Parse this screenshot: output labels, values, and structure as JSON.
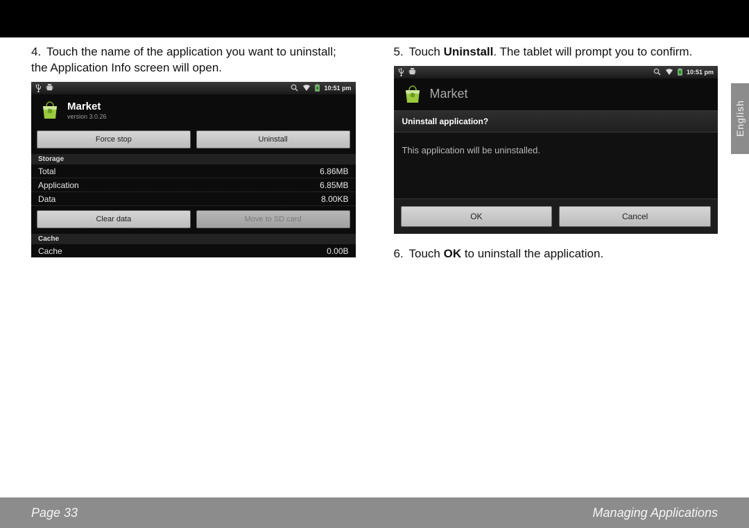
{
  "side_tab": "English",
  "footer": {
    "left": "Page 33",
    "right": "Managing Applications"
  },
  "steps": {
    "s4": {
      "num": "4.",
      "text_a": "Touch the name of the application you want to uninstall; the Application Info screen will open."
    },
    "s5": {
      "num": "5.",
      "text_a": "Touch ",
      "bold": "Uninstall",
      "text_b": ". The tablet will prompt you to confirm."
    },
    "s6": {
      "num": "6.",
      "text_a": "Touch ",
      "bold": "OK",
      "text_b": " to uninstall the application."
    }
  },
  "shot1": {
    "time": "10:51 pm",
    "app_name": "Market",
    "app_version": "version 3.0.26",
    "btn_force_stop": "Force stop",
    "btn_uninstall": "Uninstall",
    "sec_storage": "Storage",
    "rows": {
      "total_l": "Total",
      "total_v": "6.86MB",
      "app_l": "Application",
      "app_v": "6.85MB",
      "data_l": "Data",
      "data_v": "8.00KB"
    },
    "btn_clear_data": "Clear data",
    "btn_move_sd": "Move to SD card",
    "sec_cache": "Cache",
    "cache_l": "Cache",
    "cache_v": "0.00B"
  },
  "shot2": {
    "time": "10:51 pm",
    "app_name": "Market",
    "dialog_title": "Uninstall application?",
    "dialog_msg": "This application will be uninstalled.",
    "btn_ok": "OK",
    "btn_cancel": "Cancel"
  }
}
